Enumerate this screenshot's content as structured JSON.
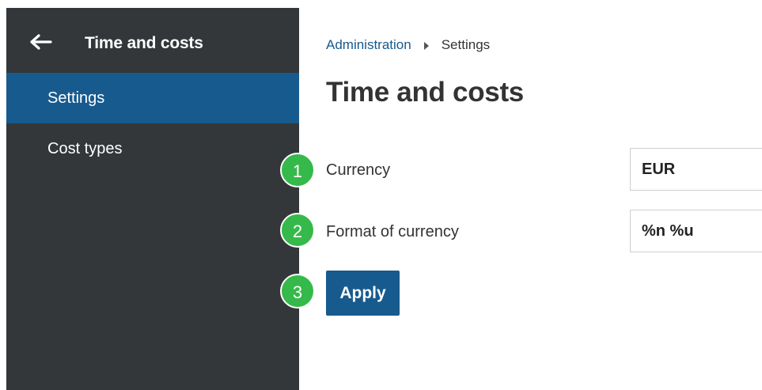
{
  "sidebar": {
    "back_icon": "arrow-left-icon",
    "title": "Time and costs",
    "items": [
      {
        "label": "Settings",
        "active": true
      },
      {
        "label": "Cost types",
        "active": false
      }
    ]
  },
  "breadcrumb": {
    "parent": "Administration",
    "separator_icon": "triangle-right-icon",
    "current": "Settings"
  },
  "page_title": "Time and costs",
  "form": {
    "currency": {
      "badge": "1",
      "label": "Currency",
      "value": "EUR"
    },
    "format": {
      "badge": "2",
      "label": "Format of currency",
      "value": "%n %u"
    },
    "apply": {
      "badge": "3",
      "label": "Apply"
    }
  },
  "colors": {
    "sidebar_bg": "#333739",
    "accent": "#175a8e",
    "badge": "#35b94a"
  }
}
